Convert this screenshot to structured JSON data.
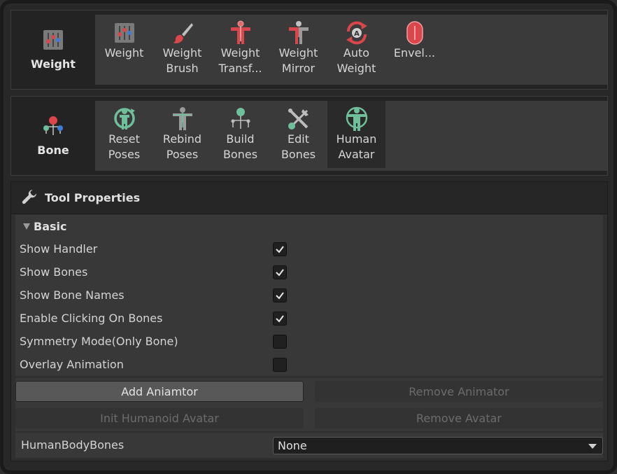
{
  "groups": {
    "weight": {
      "label": "Weight",
      "tools": [
        {
          "label": "Weight",
          "icon": "weight-sliders-icon"
        },
        {
          "label": "Weight\nBrush",
          "icon": "brush-icon"
        },
        {
          "label": "Weight\nTransf...",
          "icon": "weight-transfer-icon"
        },
        {
          "label": "Weight\nMirror",
          "icon": "weight-mirror-icon"
        },
        {
          "label": "Auto\nWeight",
          "icon": "auto-weight-icon"
        },
        {
          "label": "Envel...",
          "icon": "envelope-icon"
        }
      ]
    },
    "bone": {
      "label": "Bone",
      "tools": [
        {
          "label": "Reset\nPoses",
          "icon": "reset-poses-icon"
        },
        {
          "label": "Rebind\nPoses",
          "icon": "rebind-poses-icon"
        },
        {
          "label": "Build\nBones",
          "icon": "build-bones-icon"
        },
        {
          "label": "Edit\nBones",
          "icon": "edit-bones-icon"
        },
        {
          "label": "Human\nAvatar",
          "icon": "human-avatar-icon",
          "active": true
        }
      ]
    }
  },
  "tool_properties": {
    "title": "Tool Properties",
    "section": "Basic",
    "rows": [
      {
        "label": "Show Handler",
        "checked": true
      },
      {
        "label": "Show Bones",
        "checked": true
      },
      {
        "label": "Show Bone Names",
        "checked": true
      },
      {
        "label": "Enable Clicking On Bones",
        "checked": true
      },
      {
        "label": "Symmetry Mode(Only Bone)",
        "checked": false
      },
      {
        "label": "Overlay Animation",
        "checked": false
      }
    ],
    "buttons": {
      "add_animator": "Add Aniamtor",
      "remove_animator": "Remove Animator",
      "init_humanoid": "Init Humanoid Avatar",
      "remove_avatar": "Remove Avatar"
    },
    "human_body_bones": {
      "label": "HumanBodyBones",
      "value": "None"
    }
  },
  "colors": {
    "accent_red": "#d9464b",
    "accent_green": "#6fbf9a",
    "bone_blue": "#3d7bd6"
  }
}
